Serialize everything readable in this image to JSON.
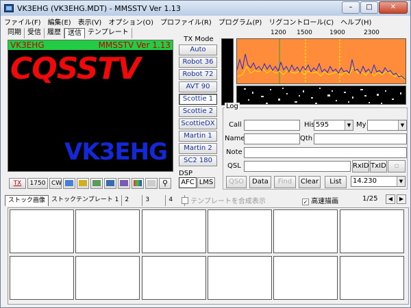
{
  "window": {
    "title": "VK3EHG (VK3EHG.MDT) - MMSSTV Ver 1.13"
  },
  "menu": [
    "ファイル(F)",
    "編集(E)",
    "表示(V)",
    "オプション(O)",
    "プロファイル(R)",
    "プログラム(P)",
    "リグコントロール(C)",
    "ヘルプ(H)"
  ],
  "tabs": [
    "同期",
    "受信",
    "履歴",
    "送信",
    "テンプレート"
  ],
  "canvas": {
    "callsign": "VK3EHG",
    "version": "MMSSTV Ver 1.13",
    "big_text": "CQSSTV",
    "big_call": "VK3EHG"
  },
  "toolbar": {
    "tx_label": "TX",
    "tone": "1750",
    "cw": "CW"
  },
  "tx_mode": {
    "title": "TX Mode",
    "modes": [
      "Auto",
      "Robot 36",
      "Robot 72",
      "AVT 90",
      "Scottie 1",
      "Scottie 2",
      "ScottieDX",
      "Martin 1",
      "Martin 2",
      "SC2 180"
    ],
    "active": "Scottie 1"
  },
  "dsp": {
    "title": "DSP",
    "afc": "AFC",
    "lms": "LMS"
  },
  "spectrum": {
    "freq_labels": [
      "1200",
      "1500",
      "1900",
      "2300"
    ]
  },
  "log": {
    "title": "Log",
    "call_label": "Call",
    "his_label": "His",
    "his_value": "595",
    "my_label": "My",
    "my_value": "",
    "name_label": "Name",
    "qth_label": "Qth",
    "note_label": "Note",
    "qsl_label": "QSL",
    "rxid": "RxID",
    "txid": "TxID",
    "buttons": [
      "QSO",
      "Data",
      "Find",
      "Clear",
      "List"
    ],
    "freq": "14.230"
  },
  "options": {
    "composite_label": "テンプレートを合成表示",
    "hq_label": "高速描画",
    "hq_checked": true,
    "page": "1/25"
  },
  "stock_tabs": [
    "ストック画像",
    "ストックテンプレート 1",
    "2",
    "3",
    "4"
  ],
  "colors": {
    "accent": "#1530a8",
    "spectrum_bg": "#ff8c3a",
    "call_red": "#ee0a0a",
    "call_blue": "#1528d8"
  }
}
